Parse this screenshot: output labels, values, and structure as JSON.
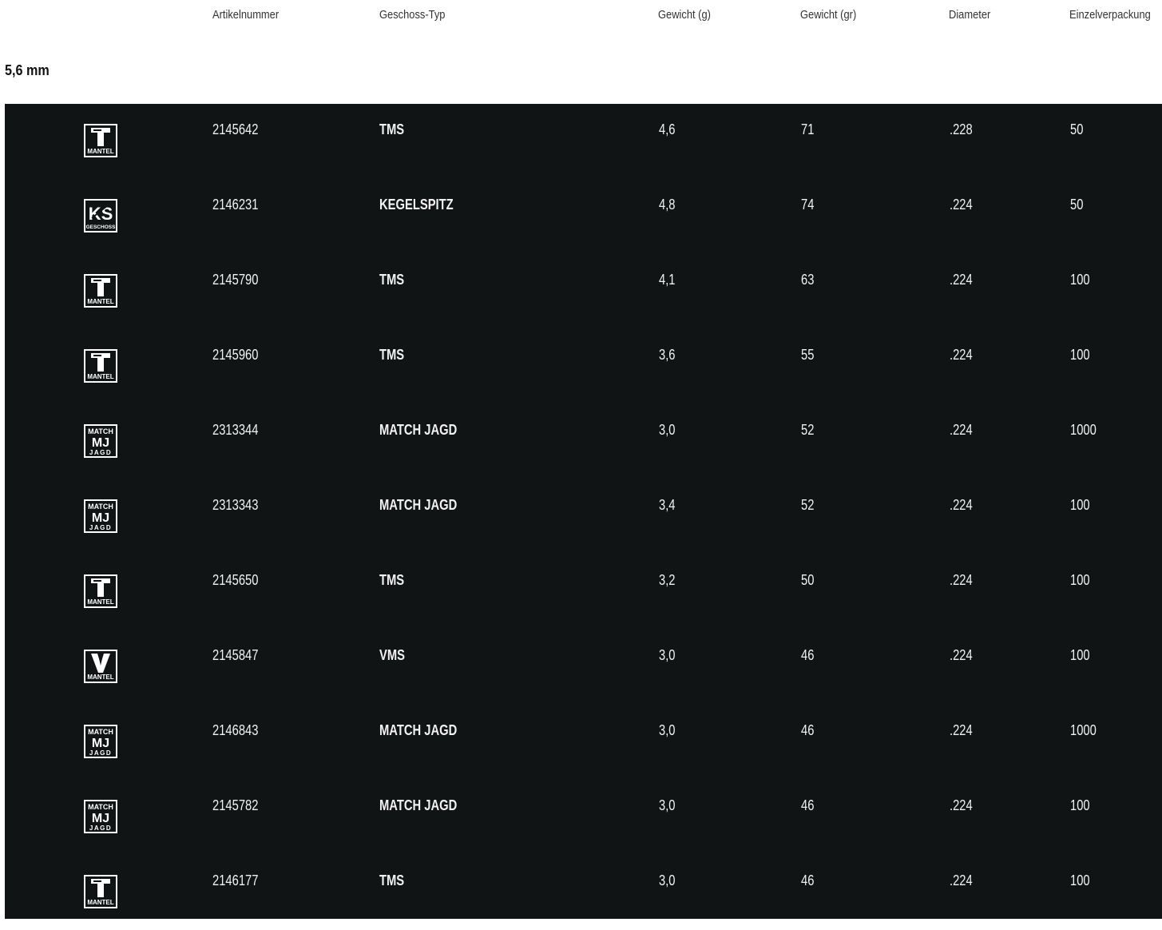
{
  "columns": {
    "artikelnummer": "Artikelnummer",
    "typ": "Geschoss-Typ",
    "gewicht_g": "Gewicht (g)",
    "gewicht_gr": "Gewicht (gr)",
    "diameter": "Diameter",
    "einzelverpackung": "Einzelverpackung"
  },
  "section": {
    "title": "5,6 mm"
  },
  "rows": [
    {
      "icon": "tms-mantel-icon",
      "icon_text": "MANTEL",
      "artikel": "2145642",
      "typ": "TMS",
      "g": "4,6",
      "gr": "71",
      "diameter": ".228",
      "pack": "50"
    },
    {
      "icon": "kegelspitz-geschoss-icon",
      "icon_text": "GESCHOSS",
      "artikel": "2146231",
      "typ": "KEGELSPITZ",
      "g": "4,8",
      "gr": "74",
      "diameter": ".224",
      "pack": "50"
    },
    {
      "icon": "tms-mantel-icon",
      "icon_text": "MANTEL",
      "artikel": "2145790",
      "typ": "TMS",
      "g": "4,1",
      "gr": "63",
      "diameter": ".224",
      "pack": "100"
    },
    {
      "icon": "tms-mantel-icon",
      "icon_text": "MANTEL",
      "artikel": "2145960",
      "typ": "TMS",
      "g": "3,6",
      "gr": "55",
      "diameter": ".224",
      "pack": "100"
    },
    {
      "icon": "match-jagd-icon",
      "icon_text": "MATCH MJ JAGD",
      "artikel": "2313344",
      "typ": "MATCH JAGD",
      "g": "3,0",
      "gr": "52",
      "diameter": ".224",
      "pack": "1000"
    },
    {
      "icon": "match-jagd-icon",
      "icon_text": "MATCH MJ JAGD",
      "artikel": "2313343",
      "typ": "MATCH JAGD",
      "g": "3,4",
      "gr": "52",
      "diameter": ".224",
      "pack": "100"
    },
    {
      "icon": "tms-mantel-icon",
      "icon_text": "MANTEL",
      "artikel": "2145650",
      "typ": "TMS",
      "g": "3,2",
      "gr": "50",
      "diameter": ".224",
      "pack": "100"
    },
    {
      "icon": "vms-mantel-icon",
      "icon_text": "MANTEL",
      "artikel": "2145847",
      "typ": "VMS",
      "g": "3,0",
      "gr": "46",
      "diameter": ".224",
      "pack": "100"
    },
    {
      "icon": "match-jagd-icon",
      "icon_text": "MATCH MJ JAGD",
      "artikel": "2146843",
      "typ": "MATCH JAGD",
      "g": "3,0",
      "gr": "46",
      "diameter": ".224",
      "pack": "1000"
    },
    {
      "icon": "match-jagd-icon",
      "icon_text": "MATCH MJ JAGD",
      "artikel": "2145782",
      "typ": "MATCH JAGD",
      "g": "3,0",
      "gr": "46",
      "diameter": ".224",
      "pack": "100"
    },
    {
      "icon": "tms-mantel-icon",
      "icon_text": "MANTEL",
      "artikel": "2146177",
      "typ": "TMS",
      "g": "3,0",
      "gr": "46",
      "diameter": ".224",
      "pack": "100"
    }
  ],
  "colors": {
    "table_bg": "#111415",
    "text_on_dark": "#f2f2f2",
    "header_text": "#333333"
  }
}
